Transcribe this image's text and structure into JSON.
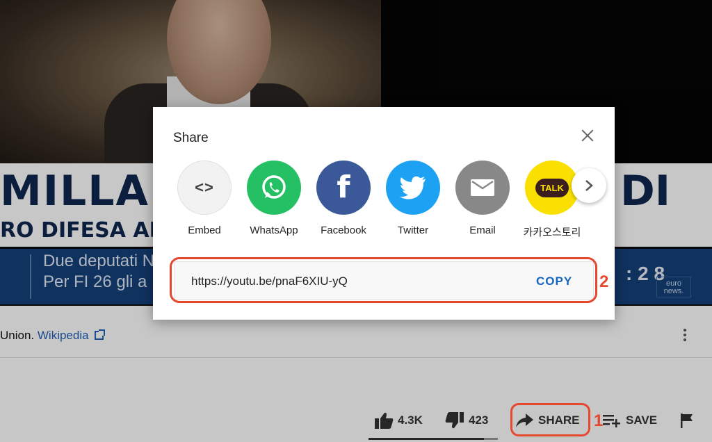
{
  "video": {
    "banner_title": "MILLAI",
    "banner_title_right": "DI",
    "banner_sub": "RO DIFESA AR",
    "lower_line1": "Due deputati N",
    "lower_line2": "Per FI 26 gli a",
    "time": ": 2 8",
    "logo": "euro news."
  },
  "description": {
    "text": "Union.",
    "link": "Wikipedia"
  },
  "actions": {
    "like_count": "4.3K",
    "dislike_count": "423",
    "share_label": "SHARE",
    "save_label": "SAVE"
  },
  "share_dialog": {
    "title": "Share",
    "targets": [
      {
        "label": "Embed",
        "icon": "embed-icon",
        "glyph": "<>"
      },
      {
        "label": "WhatsApp",
        "icon": "whatsapp-icon"
      },
      {
        "label": "Facebook",
        "icon": "facebook-icon",
        "glyph": "f"
      },
      {
        "label": "Twitter",
        "icon": "twitter-icon"
      },
      {
        "label": "Email",
        "icon": "email-icon"
      },
      {
        "label": "카카오스토리",
        "icon": "kakaostory-icon",
        "glyph": "TALK"
      }
    ],
    "url": "https://youtu.be/pnaF6XIU-yQ",
    "copy_label": "COPY"
  },
  "annotations": {
    "step1": "1",
    "step2": "2",
    "color": "#e5472f"
  },
  "colors": {
    "whatsapp": "#25c063",
    "facebook": "#3b5998",
    "twitter": "#1da1f2",
    "email": "#888888",
    "kakao": "#f9e000",
    "copy": "#1565c0"
  }
}
